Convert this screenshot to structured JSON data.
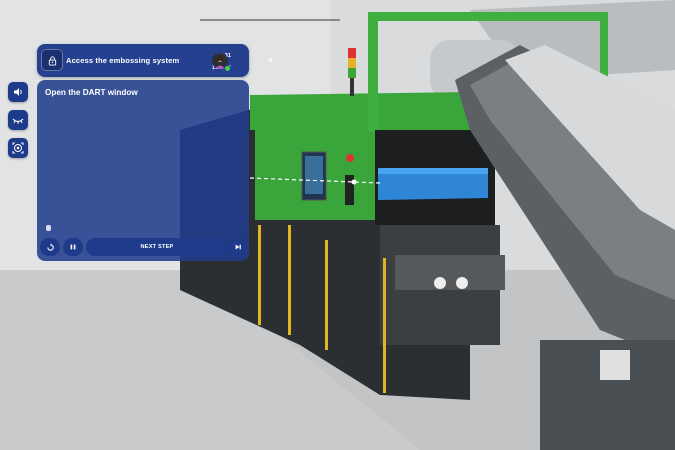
{
  "panel": {
    "title": "Access the embossing system",
    "time": "15:31",
    "battery": "100%",
    "close_label": "×",
    "step_text": "Open the DART window",
    "controls": {
      "next_label": "NEXT STEP"
    }
  },
  "side_buttons": [
    "volume-icon",
    "eye-icon",
    "target-icon"
  ],
  "colors": {
    "panel_blue": "#24408f",
    "machine_green": "#3aa53a",
    "tray_blue": "#2f86d6"
  }
}
